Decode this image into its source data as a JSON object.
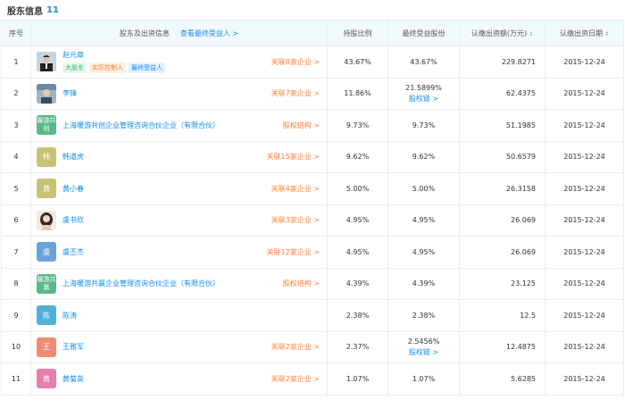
{
  "header": {
    "title": "股东信息",
    "count": "11"
  },
  "columns": {
    "index": "序号",
    "holder": "股东及出资信息",
    "beneficiary_link": "查看最终受益人 >",
    "ratio": "持股比例",
    "final_share": "最终受益股份",
    "capital": "认缴出资额(万元)",
    "date": "认缴出资日期",
    "sort_glyph": "⇕"
  },
  "rows": [
    {
      "index": "1",
      "avatar_text": "",
      "avatar_color": "#3b4a5a",
      "photo": "man",
      "name": "赵元章",
      "tags": [
        "大股东",
        "实际控制人",
        "最终受益人"
      ],
      "relation": "关联8家企业 >",
      "ratio": "43.67%",
      "final_share": "43.67%",
      "chain": "",
      "capital": "229.8271",
      "date": "2015-12-24"
    },
    {
      "index": "2",
      "avatar_text": "",
      "avatar_color": "#8aa0b3",
      "photo": "man2",
      "name": "李锋",
      "tags": [],
      "relation": "关联7家企业 >",
      "ratio": "11.86%",
      "final_share": "21.5899%",
      "chain": "股权链 >",
      "capital": "62.4375",
      "date": "2015-12-24"
    },
    {
      "index": "3",
      "avatar_text": "暖游共创",
      "avatar_color": "#5ab88a",
      "photo": "",
      "name": "上海暖游共创企业管理咨询合伙企业（有限合伙）",
      "tags": [],
      "relation": "股权结构 >",
      "ratio": "9.73%",
      "final_share": "9.73%",
      "chain": "",
      "capital": "51.1985",
      "date": "2015-12-24"
    },
    {
      "index": "4",
      "avatar_text": "韩",
      "avatar_color": "#c8c374",
      "photo": "",
      "name": "韩道虎",
      "tags": [],
      "relation": "关联15家企业 >",
      "ratio": "9.62%",
      "final_share": "9.62%",
      "chain": "",
      "capital": "50.6579",
      "date": "2015-12-24"
    },
    {
      "index": "5",
      "avatar_text": "黄",
      "avatar_color": "#c8c374",
      "photo": "",
      "name": "黄小春",
      "tags": [],
      "relation": "关联4家企业 >",
      "ratio": "5.00%",
      "final_share": "5.00%",
      "chain": "",
      "capital": "26.3158",
      "date": "2015-12-24"
    },
    {
      "index": "6",
      "avatar_text": "",
      "avatar_color": "#e9e4df",
      "photo": "woman",
      "name": "虞书欣",
      "tags": [],
      "relation": "关联3家企业 >",
      "ratio": "4.95%",
      "final_share": "4.95%",
      "chain": "",
      "capital": "26.069",
      "date": "2015-12-24"
    },
    {
      "index": "7",
      "avatar_text": "虞",
      "avatar_color": "#6aa3d8",
      "photo": "",
      "name": "虞丕杰",
      "tags": [],
      "relation": "关联12家企业 >",
      "ratio": "4.95%",
      "final_share": "4.95%",
      "chain": "",
      "capital": "26.069",
      "date": "2015-12-24"
    },
    {
      "index": "8",
      "avatar_text": "暖游共赢",
      "avatar_color": "#5ab88a",
      "photo": "",
      "name": "上海暖游共赢企业管理咨询合伙企业（有限合伙）",
      "tags": [],
      "relation": "股权结构 >",
      "ratio": "4.39%",
      "final_share": "4.39%",
      "chain": "",
      "capital": "23.125",
      "date": "2015-12-24"
    },
    {
      "index": "9",
      "avatar_text": "陈",
      "avatar_color": "#4fb0d8",
      "photo": "",
      "name": "陈涛",
      "tags": [],
      "relation": "",
      "ratio": "2.38%",
      "final_share": "2.38%",
      "chain": "",
      "capital": "12.5",
      "date": "2015-12-24"
    },
    {
      "index": "10",
      "avatar_text": "王",
      "avatar_color": "#ef8a76",
      "photo": "",
      "name": "王雅军",
      "tags": [],
      "relation": "关联2家企业 >",
      "ratio": "2.37%",
      "final_share": "2.5456%",
      "chain": "股权链 >",
      "capital": "12.4875",
      "date": "2015-12-24"
    },
    {
      "index": "11",
      "avatar_text": "黄",
      "avatar_color": "#e77fae",
      "photo": "",
      "name": "黄菊英",
      "tags": [],
      "relation": "关联2家企业 >",
      "ratio": "1.07%",
      "final_share": "1.07%",
      "chain": "",
      "capital": "5.6285",
      "date": "2015-12-24"
    }
  ]
}
